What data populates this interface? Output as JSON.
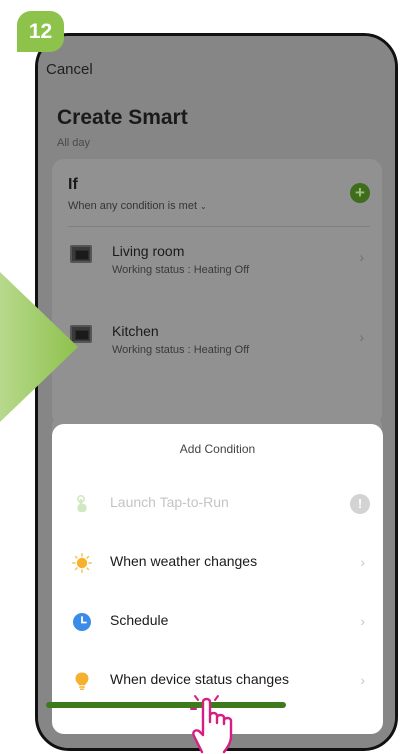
{
  "step": {
    "number": "12"
  },
  "nav": {
    "cancel_label": "Cancel"
  },
  "page": {
    "title": "Create Smart",
    "subtitle": "All day"
  },
  "if_section": {
    "label": "If",
    "mode": "When any condition is met",
    "conditions": [
      {
        "title": "Living room",
        "status": "Working status : Heating Off"
      },
      {
        "title": "Kitchen",
        "status": "Working status : Heating Off"
      }
    ]
  },
  "sheet": {
    "title": "Add Condition",
    "options": [
      {
        "label": "Launch Tap-to-Run",
        "icon": "tap-icon",
        "enabled": false
      },
      {
        "label": "When weather changes",
        "icon": "sun-icon",
        "enabled": true
      },
      {
        "label": "Schedule",
        "icon": "clock-icon",
        "enabled": true
      },
      {
        "label": "When device status changes",
        "icon": "bulb-icon",
        "enabled": true
      }
    ]
  },
  "colors": {
    "accent_green": "#8dc34a",
    "sun": "#f7b22a",
    "schedule_blue": "#3d8be8",
    "bulb": "#f5b02e"
  }
}
